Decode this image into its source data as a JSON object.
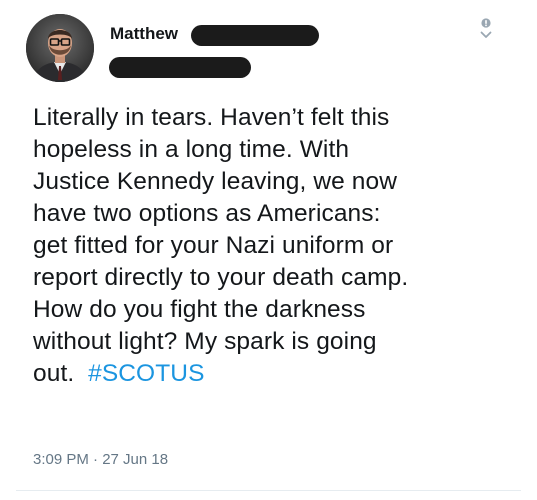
{
  "tweet": {
    "author_name": "Matthew",
    "lines": [
      "Literally in tears. Haven’t felt this",
      "hopeless in a long time. With",
      "Justice Kennedy leaving, we now",
      "have two options as Americans:",
      "get fitted for your Nazi uniform or",
      "report directly to your death camp.",
      "How do you fight the darkness",
      "without light? My spark is going"
    ],
    "last_line_prefix": "out.",
    "hashtag": "#SCOTUS",
    "timestamp": "3:09 PM · 27 Jun 18"
  },
  "colors": {
    "hashtag": "#1b95e0",
    "timestamp": "#657786",
    "redaction": "#1b1b1b"
  },
  "icons": {
    "more": "chevron-down-icon"
  }
}
